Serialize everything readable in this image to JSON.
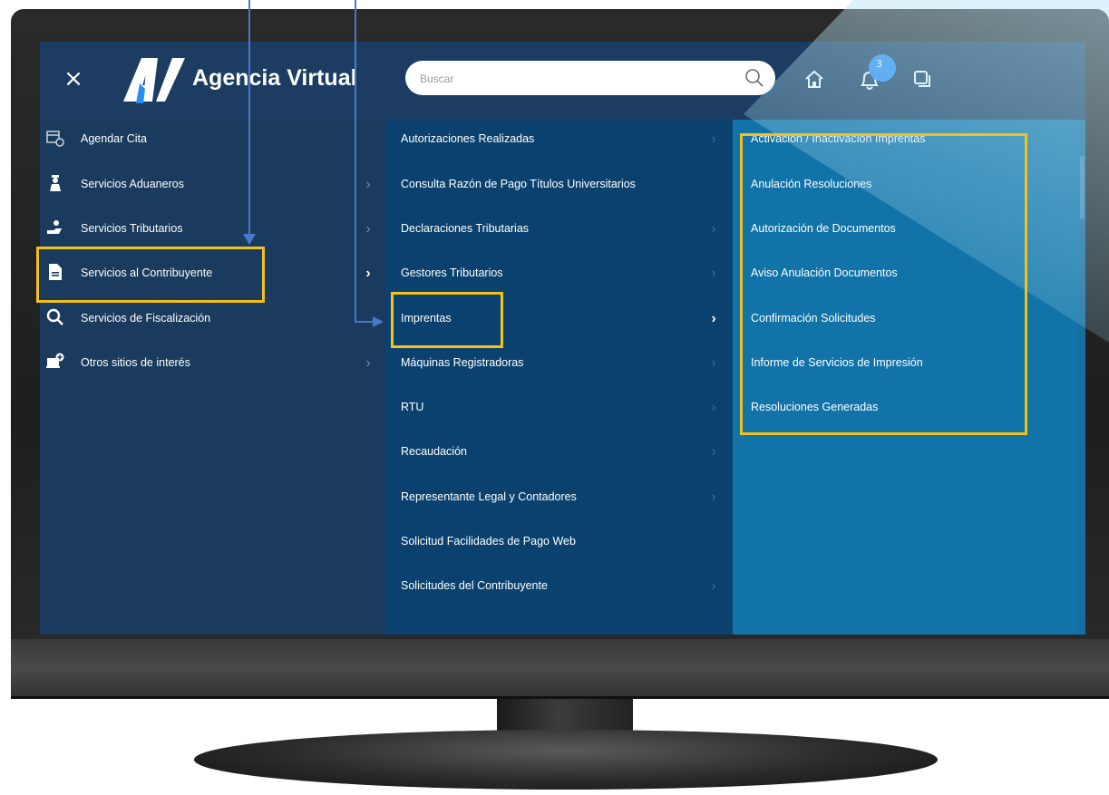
{
  "app": {
    "title": "Agencia Virtual",
    "close_label": "×"
  },
  "search": {
    "placeholder": "Buscar"
  },
  "header": {
    "notification_count": "3"
  },
  "sidebar": {
    "items": [
      {
        "label": "Agendar Cita",
        "icon": "calendar-clock-icon",
        "has_submenu": false
      },
      {
        "label": "Servicios Aduaneros",
        "icon": "customs-officer-icon",
        "has_submenu": true
      },
      {
        "label": "Servicios Tributarios",
        "icon": "hand-coins-icon",
        "has_submenu": true
      },
      {
        "label": "Servicios al Contribuyente",
        "icon": "document-icon",
        "has_submenu": true,
        "active": true
      },
      {
        "label": "Servicios de Fiscalización",
        "icon": "magnifier-icon",
        "has_submenu": false
      },
      {
        "label": "Otros sitios de interés",
        "icon": "computer-plus-icon",
        "has_submenu": true
      }
    ]
  },
  "submenu": {
    "items": [
      {
        "label": "Autorizaciones Realizadas",
        "has_submenu": true
      },
      {
        "label": "Consulta Razón de Pago Títulos Universitarios",
        "has_submenu": false
      },
      {
        "label": "Declaraciones Tributarias",
        "has_submenu": true
      },
      {
        "label": "Gestores Tributarios",
        "has_submenu": true
      },
      {
        "label": "Imprentas",
        "has_submenu": true,
        "active": true
      },
      {
        "label": "Máquinas Registradoras",
        "has_submenu": true
      },
      {
        "label": "RTU",
        "has_submenu": true
      },
      {
        "label": "Recaudación",
        "has_submenu": true
      },
      {
        "label": "Representante Legal y Contadores",
        "has_submenu": true
      },
      {
        "label": "Solicitud Facilidades de Pago Web",
        "has_submenu": false
      },
      {
        "label": "Solicitudes del Contribuyente",
        "has_submenu": true
      }
    ]
  },
  "subsubmenu": {
    "items": [
      {
        "label": "Activación / Inactivación Imprentas"
      },
      {
        "label": "Anulación Resoluciones"
      },
      {
        "label": "Autorización de Documentos"
      },
      {
        "label": "Aviso Anulación Documentos"
      },
      {
        "label": "Confirmación Solicitudes"
      },
      {
        "label": "Informe de Servicios de Impresión"
      },
      {
        "label": "Resoluciones Generadas"
      }
    ]
  },
  "colors": {
    "highlight": "#f3c01c",
    "arrow": "#4a78c8",
    "col1_bg": "#1a3b5e",
    "col2_bg": "#0b416e",
    "col3_bg": "#1173a8",
    "badge": "#2a8df0"
  }
}
